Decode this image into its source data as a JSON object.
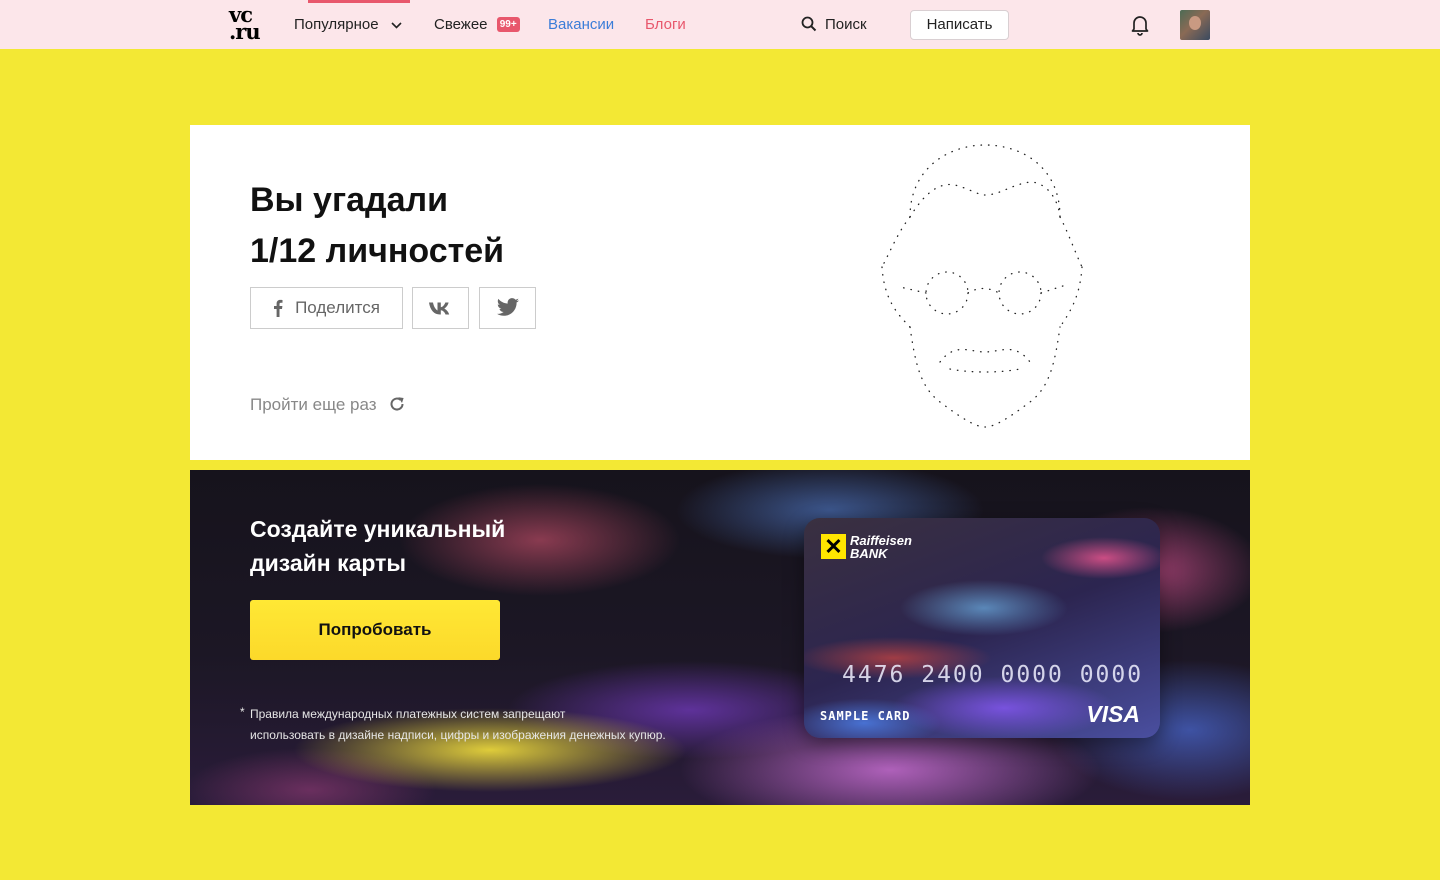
{
  "header": {
    "logo_top": "vc",
    "logo_bottom": ".ru",
    "nav": {
      "popular": "Популярное",
      "fresh": "Свежее",
      "fresh_badge": "99+",
      "jobs": "Вакансии",
      "blogs": "Блоги"
    },
    "search_label": "Поиск",
    "write_button": "Написать",
    "colors": {
      "accent": "#e8576c",
      "link_blue": "#3b7dd8",
      "header_bg": "#fce6ea"
    }
  },
  "result": {
    "title_line1": "Вы угадали",
    "title_line2": "1/12 личностей",
    "share_facebook": "Поделится",
    "retry_label": "Пройти еще раз",
    "icons": [
      "facebook-icon",
      "vk-icon",
      "twitter-icon",
      "refresh-icon",
      "face-outline-icon"
    ]
  },
  "promo": {
    "title_line1": "Создайте уникальный",
    "title_line2": "дизайн карты",
    "button": "Попробовать",
    "disclaimer_star": "*",
    "disclaimer_line1": "Правила международных платежных систем запрещают",
    "disclaimer_line2": "использовать в дизайне надписи, цифры и изображения денежных купюр.",
    "card": {
      "bank_line1": "Raiffeisen",
      "bank_line2": "BANK",
      "number": "4476 2400 0000 0000",
      "label": "SAMPLE CARD",
      "network": "VISA"
    }
  },
  "page_background": "#f3e834"
}
